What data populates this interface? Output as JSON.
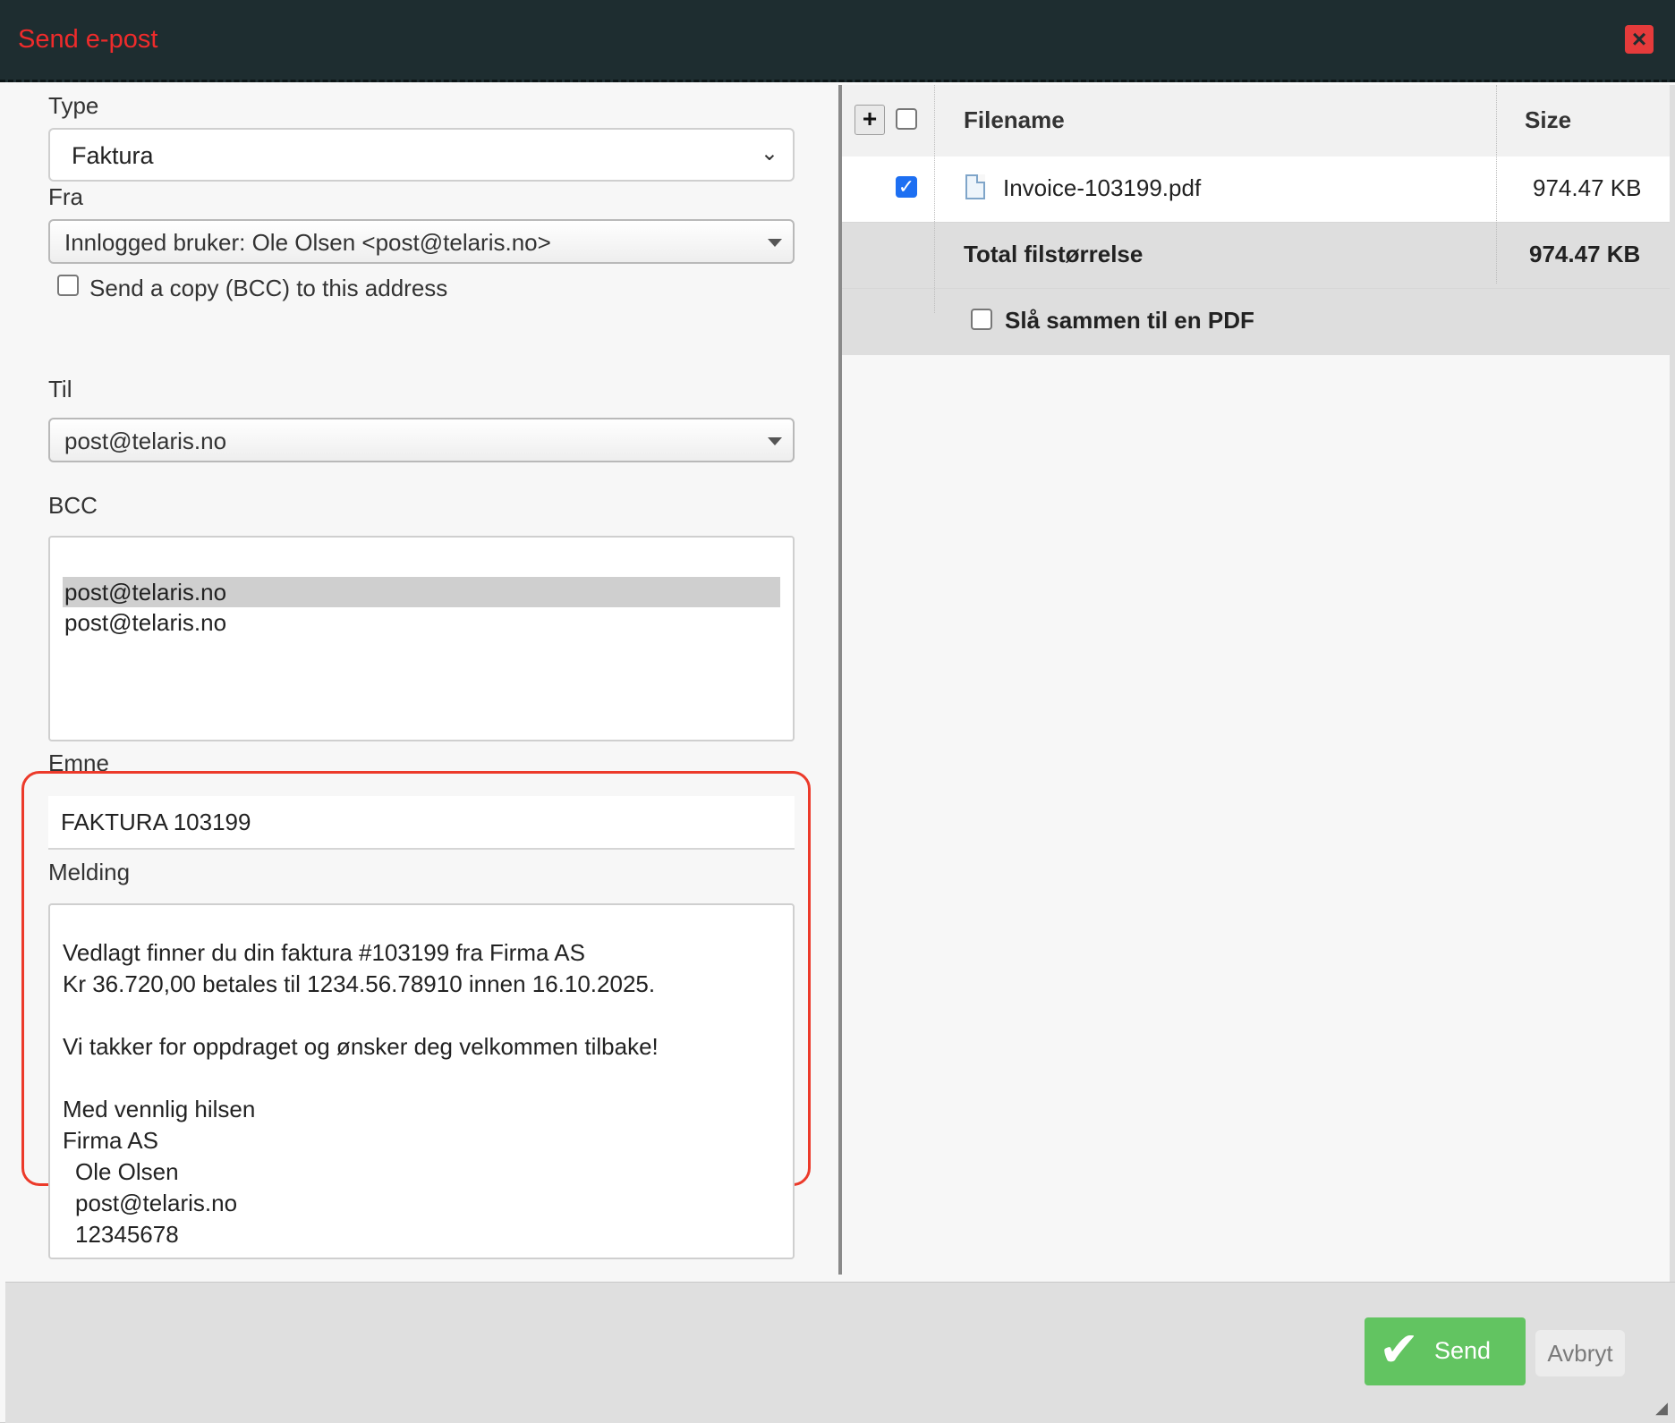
{
  "dialog": {
    "title": "Send e-post",
    "close_label": "×"
  },
  "left": {
    "type_label": "Type",
    "type_value": "Faktura",
    "from_label": "Fra",
    "from_value": "Innlogged bruker: Ole Olsen <post@telaris.no>",
    "bcc_copy_label": "Send a copy (BCC) to this address",
    "to_label": "Til",
    "to_value": "post@telaris.no",
    "bcc_label": "BCC",
    "bcc_options": [
      "post@telaris.no",
      "post@telaris.no"
    ],
    "subject_label": "Emne",
    "subject_value": "FAKTURA 103199",
    "message_label": "Melding",
    "message_lines": [
      "Vedlagt finner du din faktura #103199 fra Firma AS",
      "Kr 36.720,00 betales til 1234.56.78910 innen 16.10.2025.",
      "",
      "Vi takker for oppdraget og ønsker deg velkommen tilbake!",
      "",
      "Med vennlig hilsen",
      "Firma AS",
      "Ole Olsen",
      "post@telaris.no",
      "12345678"
    ]
  },
  "attachments": {
    "add_label": "+",
    "col_filename": "Filename",
    "col_size": "Size",
    "files": [
      {
        "name": "Invoice-103199.pdf",
        "size": "974.47 KB",
        "checked": true
      }
    ],
    "total_label": "Total filstørrelse",
    "total_size": "974.47 KB",
    "merge_label": "Slå sammen til en PDF"
  },
  "footer": {
    "send_label": "Send",
    "cancel_label": "Avbryt"
  },
  "colors": {
    "title_red": "#ef2b2b",
    "send_green": "#62c461",
    "highlight_red": "#ec3a2a"
  }
}
